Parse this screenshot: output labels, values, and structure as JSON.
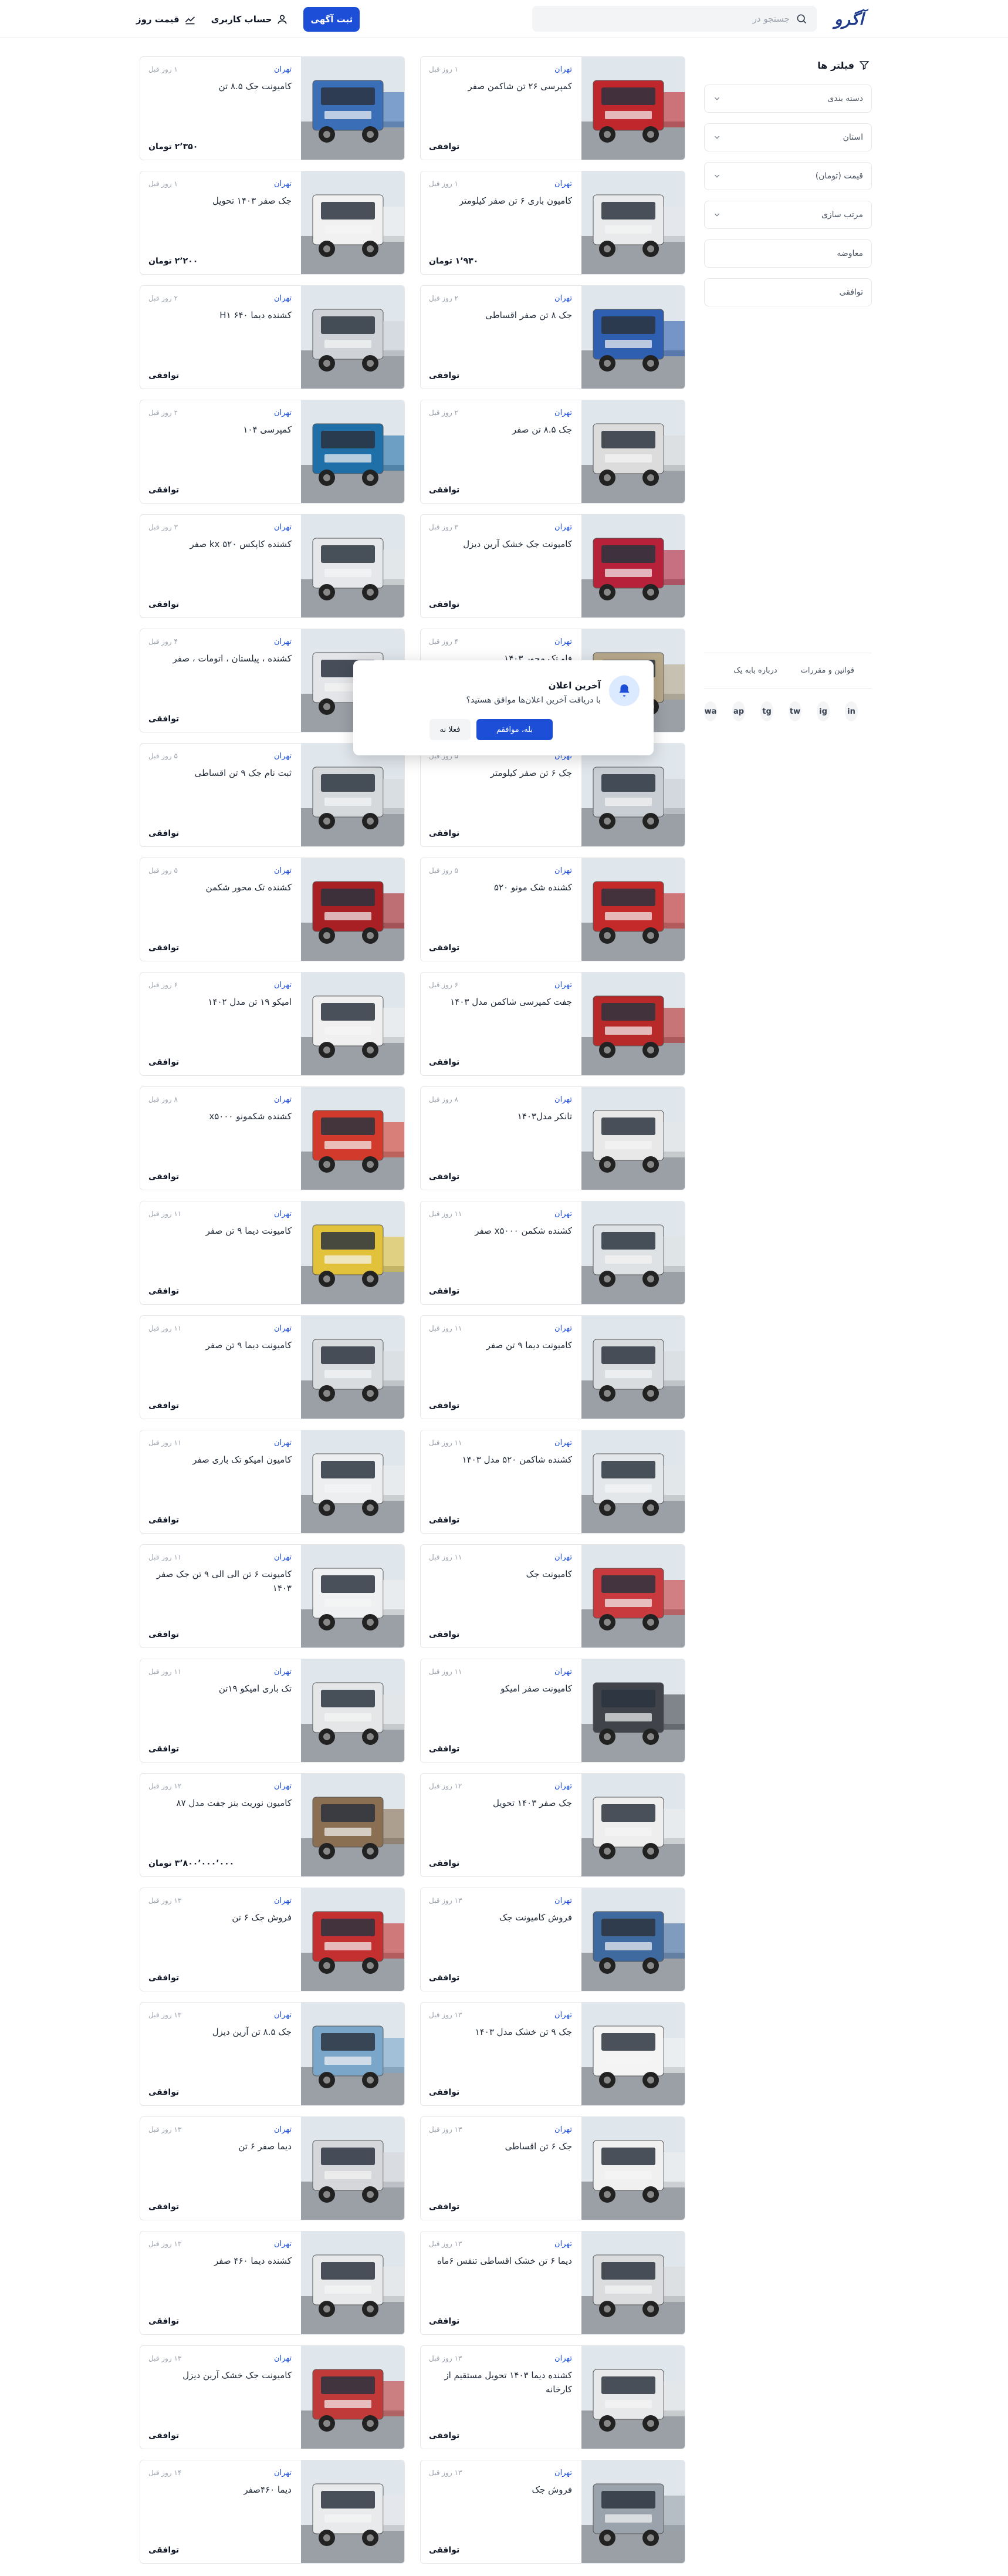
{
  "header": {
    "logo_text": "آگرو",
    "search_placeholder": "جستجو در",
    "price_today": "قیمت روز",
    "account": "حساب کاربری",
    "post_ad": "ثبت آگهی"
  },
  "sidebar": {
    "filters_title": "فیلتر ها",
    "filters": [
      {
        "label": "دسته بندی",
        "has_chevron": true
      },
      {
        "label": "استان",
        "has_chevron": true
      },
      {
        "label": "قیمت (تومان)",
        "has_chevron": true
      },
      {
        "label": "مرتب سازی",
        "has_chevron": true
      },
      {
        "label": "معاوضه",
        "has_chevron": false
      },
      {
        "label": "توافقی",
        "has_chevron": false
      }
    ],
    "footer_links": [
      "قوانین و مقررات",
      "درباره بابه یک"
    ],
    "social": [
      "in",
      "ig",
      "tw",
      "tg",
      "ap",
      "wa"
    ]
  },
  "modal": {
    "title": "آخرین اعلان",
    "text": "با دریافت آخرین اعلان‌ها موافق هستید؟",
    "yes": "بله، موافقم",
    "no": "فعلا نه"
  },
  "listings": [
    {
      "city": "تهران",
      "time": "۱ روز قبل",
      "title": "کمپرسی ۲۶ تن شاکمن صفر",
      "price": "توافقی",
      "color": "#c0272d"
    },
    {
      "city": "تهران",
      "time": "۱ روز قبل",
      "title": "کامیونت جک ۸.۵ تن",
      "price": "۲٬۳۵۰ تومان",
      "color": "#3a6fb8"
    },
    {
      "city": "تهران",
      "time": "۱ روز قبل",
      "title": "کامیون باری ۶ تن صفر کیلومتر",
      "price": "۱٬۹۳۰ تومان",
      "color": "#e8eaec"
    },
    {
      "city": "تهران",
      "time": "۱ روز قبل",
      "title": "جک صفر ۱۴۰۳ تحویل",
      "price": "۲٬۲۰۰ تومان",
      "color": "#f1f1f1"
    },
    {
      "city": "تهران",
      "time": "۲ روز قبل",
      "title": "جک ۸ تن صفر اقساطی",
      "price": "توافقی",
      "color": "#2f5fb0"
    },
    {
      "city": "تهران",
      "time": "۲ روز قبل",
      "title": "کشنده دیما H۱ ۶۴۰",
      "price": "توافقی",
      "color": "#cfd3d8"
    },
    {
      "city": "تهران",
      "time": "۲ روز قبل",
      "title": "جک ۸.۵ تن صفر",
      "price": "توافقی",
      "color": "#dcdcdc"
    },
    {
      "city": "تهران",
      "time": "۲ روز قبل",
      "title": "کمپرسی ۱۰۴",
      "price": "توافقی",
      "color": "#1f6fa8"
    },
    {
      "city": "تهران",
      "time": "۳ روز قبل",
      "title": "کامیونت جک خشک آرین دیزل",
      "price": "توافقی",
      "color": "#b7223a"
    },
    {
      "city": "تهران",
      "time": "۳ روز قبل",
      "title": "کشنده کاپکس ۵۲۰ kx صفر",
      "price": "توافقی",
      "color": "#e5e7ea"
    },
    {
      "city": "تهران",
      "time": "۴ روز قبل",
      "title": "فاو تک محور ۱۴۰۳",
      "price": "توافقی",
      "color": "#b8a88a"
    },
    {
      "city": "تهران",
      "time": "۴ روز قبل",
      "title": "کشنده ، پیلستان ، اتومات ، صفر",
      "price": "توافقی",
      "color": "#e3e5e8"
    },
    {
      "city": "تهران",
      "time": "۵ روز قبل",
      "title": "جک ۶ تن صفر کیلومتر",
      "price": "توافقی",
      "color": "#c9ced4"
    },
    {
      "city": "تهران",
      "time": "۵ روز قبل",
      "title": "ثبت نام جک ۹ تن اقساطی",
      "price": "توافقی",
      "color": "#d6d9dc"
    },
    {
      "city": "تهران",
      "time": "۵ روز قبل",
      "title": "کشنده شک مونو ۵۲۰",
      "price": "توافقی",
      "color": "#c52a2a"
    },
    {
      "city": "تهران",
      "time": "۵ روز قبل",
      "title": "کشنده تک محور شکمن",
      "price": "توافقی",
      "color": "#a81f24"
    },
    {
      "city": "تهران",
      "time": "۶ روز قبل",
      "title": "جفت کمپرسی شاکمن مدل ۱۴۰۳",
      "price": "توافقی",
      "color": "#b82a2a"
    },
    {
      "city": "تهران",
      "time": "۶ روز قبل",
      "title": "امیکو ۱۹ تن مدل ۱۴۰۲",
      "price": "توافقی",
      "color": "#f0f0f0"
    },
    {
      "city": "تهران",
      "time": "۸ روز قبل",
      "title": "تانکر مدل۱۴۰۳",
      "price": "توافقی",
      "color": "#e8e8e8"
    },
    {
      "city": "تهران",
      "time": "۸ روز قبل",
      "title": "کشنده شکمونو x۵۰۰۰",
      "price": "توافقی",
      "color": "#d23a2c"
    },
    {
      "city": "تهران",
      "time": "۱۱ روز قبل",
      "title": "کشنده شکمن x۵۰۰۰ صفر",
      "price": "توافقی",
      "color": "#dfe2e5"
    },
    {
      "city": "تهران",
      "time": "۱۱ روز قبل",
      "title": "کامیونت دیما ۹ تن صفر",
      "price": "توافقی",
      "color": "#e1c23a"
    },
    {
      "city": "تهران",
      "time": "۱۱ روز قبل",
      "title": "کامیونت دیما ۹ تن صفر",
      "price": "توافقی",
      "color": "#d9dcdf"
    },
    {
      "city": "تهران",
      "time": "۱۱ روز قبل",
      "title": "کامیونت دیما ۹ تن صفر",
      "price": "توافقی",
      "color": "#d9dcdf"
    },
    {
      "city": "تهران",
      "time": "۱۱ روز قبل",
      "title": "کشنده شاکمن ۵۲۰ مدل ۱۴۰۳",
      "price": "توافقی",
      "color": "#e4e7ea"
    },
    {
      "city": "تهران",
      "time": "۱۱ روز قبل",
      "title": "کامیون امیکو تک باری صفر",
      "price": "توافقی",
      "color": "#eceef0"
    },
    {
      "city": "تهران",
      "time": "۱۱ روز قبل",
      "title": "کامیونت جک",
      "price": "توافقی",
      "color": "#c93a3e"
    },
    {
      "city": "تهران",
      "time": "۱۱ روز قبل",
      "title": "کامیونت ۶ تن الی الی ۹ تن جک صفر ۱۴۰۳",
      "price": "توافقی",
      "color": "#eef0f2"
    },
    {
      "city": "تهران",
      "time": "۱۱ روز قبل",
      "title": "کامیونت صفر امیکو",
      "price": "توافقی",
      "color": "#40444a"
    },
    {
      "city": "تهران",
      "time": "۱۱ روز قبل",
      "title": "تک باری امیکو ۱۹تن",
      "price": "توافقی",
      "color": "#e4e6e8"
    },
    {
      "city": "تهران",
      "time": "۱۲ روز قبل",
      "title": "جک صفر ۱۴۰۳ تحویل",
      "price": "توافقی",
      "color": "#eeeeee"
    },
    {
      "city": "تهران",
      "time": "۱۲ روز قبل",
      "title": "کامیون نوریت بنز جفت مدل ۸۷",
      "price": "۳٬۸۰۰٬۰۰۰٬۰۰۰ تومان",
      "color": "#8a6f52"
    },
    {
      "city": "تهران",
      "time": "۱۳ روز قبل",
      "title": "فروش کامیونت جک",
      "price": "توافقی",
      "color": "#3f6aa0"
    },
    {
      "city": "تهران",
      "time": "۱۳ روز قبل",
      "title": "فروش جک ۶ تن",
      "price": "توافقی",
      "color": "#c43030"
    },
    {
      "city": "تهران",
      "time": "۱۳ روز قبل",
      "title": "جک ۹ تن خشک مدل ۱۴۰۳",
      "price": "توافقی",
      "color": "#f4f4f4"
    },
    {
      "city": "تهران",
      "time": "۱۳ روز قبل",
      "title": "جک ۸.۵ تن آرین دیزل",
      "price": "توافقی",
      "color": "#7aa6c9"
    },
    {
      "city": "تهران",
      "time": "۱۳ روز قبل",
      "title": "جک ۶ تن اقساطی",
      "price": "توافقی",
      "color": "#f0f0f0"
    },
    {
      "city": "تهران",
      "time": "۱۳ روز قبل",
      "title": "دیما صفر ۶ تن",
      "price": "توافقی",
      "color": "#d5d7da"
    },
    {
      "city": "تهران",
      "time": "۱۳ روز قبل",
      "title": "دیما ۶ تن خشک اقساطی تنفس ۶ماه",
      "price": "توافقی",
      "color": "#dadcde"
    },
    {
      "city": "تهران",
      "time": "۱۳ روز قبل",
      "title": "کشنده دیما ۴۶۰ صفر",
      "price": "توافقی",
      "color": "#e7e9eb"
    },
    {
      "city": "تهران",
      "time": "۱۳ روز قبل",
      "title": "کشنده دیما ۱۴۰۳ تحویل مستقیم از کارخانه",
      "price": "توافقی",
      "color": "#e6e8ea"
    },
    {
      "city": "تهران",
      "time": "۱۳ روز قبل",
      "title": "کامیونت جک خشک آرین دیزل",
      "price": "توافقی",
      "color": "#c03a3a"
    },
    {
      "city": "تهران",
      "time": "۱۳ روز قبل",
      "title": "فروش جک",
      "price": "توافقی",
      "color": "#9aa3ab"
    },
    {
      "city": "تهران",
      "time": "۱۴ روز قبل",
      "title": "دیما ۴۶۰صفر",
      "price": "توافقی",
      "color": "#e8eaec"
    }
  ]
}
